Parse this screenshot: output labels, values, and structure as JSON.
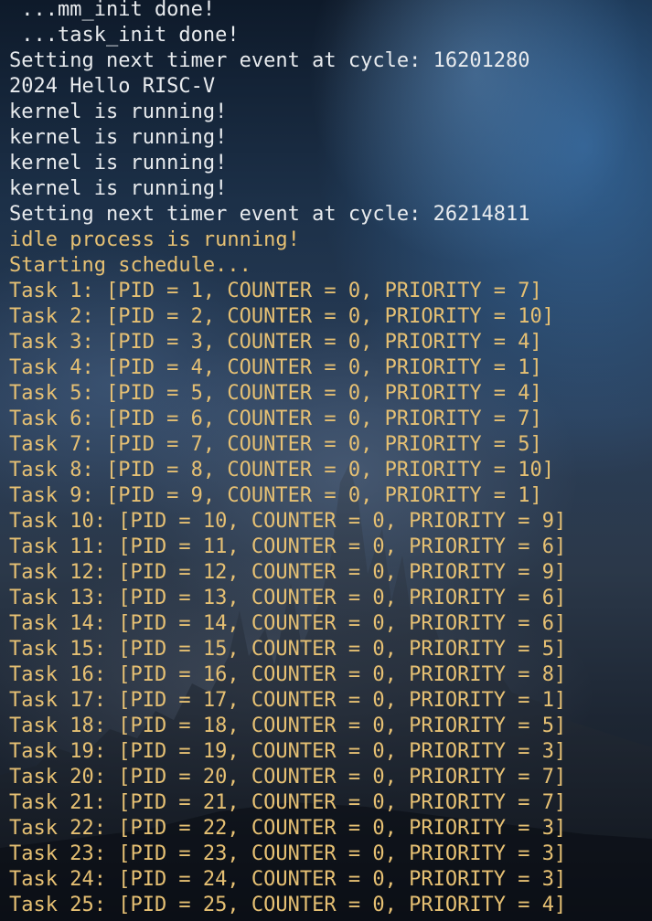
{
  "terminal": {
    "lines": [
      {
        "text": " ...mm_init done!",
        "color": "white"
      },
      {
        "text": " ...task_init done!",
        "color": "white"
      },
      {
        "text": "Setting next timer event at cycle: 16201280",
        "color": "white"
      },
      {
        "text": "2024 Hello RISC-V",
        "color": "white"
      },
      {
        "text": "kernel is running!",
        "color": "white"
      },
      {
        "text": "kernel is running!",
        "color": "white"
      },
      {
        "text": "kernel is running!",
        "color": "white"
      },
      {
        "text": "kernel is running!",
        "color": "white"
      },
      {
        "text": "Setting next timer event at cycle: 26214811",
        "color": "white"
      },
      {
        "text": "idle process is running!",
        "color": "yellow"
      },
      {
        "text": "Starting schedule...",
        "color": "yellow"
      },
      {
        "text": "Task 1: [PID = 1, COUNTER = 0, PRIORITY = 7]",
        "color": "yellow"
      },
      {
        "text": "Task 2: [PID = 2, COUNTER = 0, PRIORITY = 10]",
        "color": "yellow"
      },
      {
        "text": "Task 3: [PID = 3, COUNTER = 0, PRIORITY = 4]",
        "color": "yellow"
      },
      {
        "text": "Task 4: [PID = 4, COUNTER = 0, PRIORITY = 1]",
        "color": "yellow"
      },
      {
        "text": "Task 5: [PID = 5, COUNTER = 0, PRIORITY = 4]",
        "color": "yellow"
      },
      {
        "text": "Task 6: [PID = 6, COUNTER = 0, PRIORITY = 7]",
        "color": "yellow"
      },
      {
        "text": "Task 7: [PID = 7, COUNTER = 0, PRIORITY = 5]",
        "color": "yellow"
      },
      {
        "text": "Task 8: [PID = 8, COUNTER = 0, PRIORITY = 10]",
        "color": "yellow"
      },
      {
        "text": "Task 9: [PID = 9, COUNTER = 0, PRIORITY = 1]",
        "color": "yellow"
      },
      {
        "text": "Task 10: [PID = 10, COUNTER = 0, PRIORITY = 9]",
        "color": "yellow"
      },
      {
        "text": "Task 11: [PID = 11, COUNTER = 0, PRIORITY = 6]",
        "color": "yellow"
      },
      {
        "text": "Task 12: [PID = 12, COUNTER = 0, PRIORITY = 9]",
        "color": "yellow"
      },
      {
        "text": "Task 13: [PID = 13, COUNTER = 0, PRIORITY = 6]",
        "color": "yellow"
      },
      {
        "text": "Task 14: [PID = 14, COUNTER = 0, PRIORITY = 6]",
        "color": "yellow"
      },
      {
        "text": "Task 15: [PID = 15, COUNTER = 0, PRIORITY = 5]",
        "color": "yellow"
      },
      {
        "text": "Task 16: [PID = 16, COUNTER = 0, PRIORITY = 8]",
        "color": "yellow"
      },
      {
        "text": "Task 17: [PID = 17, COUNTER = 0, PRIORITY = 1]",
        "color": "yellow"
      },
      {
        "text": "Task 18: [PID = 18, COUNTER = 0, PRIORITY = 5]",
        "color": "yellow"
      },
      {
        "text": "Task 19: [PID = 19, COUNTER = 0, PRIORITY = 3]",
        "color": "yellow"
      },
      {
        "text": "Task 20: [PID = 20, COUNTER = 0, PRIORITY = 7]",
        "color": "yellow"
      },
      {
        "text": "Task 21: [PID = 21, COUNTER = 0, PRIORITY = 7]",
        "color": "yellow"
      },
      {
        "text": "Task 22: [PID = 22, COUNTER = 0, PRIORITY = 3]",
        "color": "yellow"
      },
      {
        "text": "Task 23: [PID = 23, COUNTER = 0, PRIORITY = 3]",
        "color": "yellow"
      },
      {
        "text": "Task 24: [PID = 24, COUNTER = 0, PRIORITY = 3]",
        "color": "yellow"
      },
      {
        "text": "Task 25: [PID = 25, COUNTER = 0, PRIORITY = 4]",
        "color": "yellow"
      }
    ]
  },
  "colors": {
    "white_text": "#e8ebee",
    "yellow_text": "#e6c073"
  }
}
